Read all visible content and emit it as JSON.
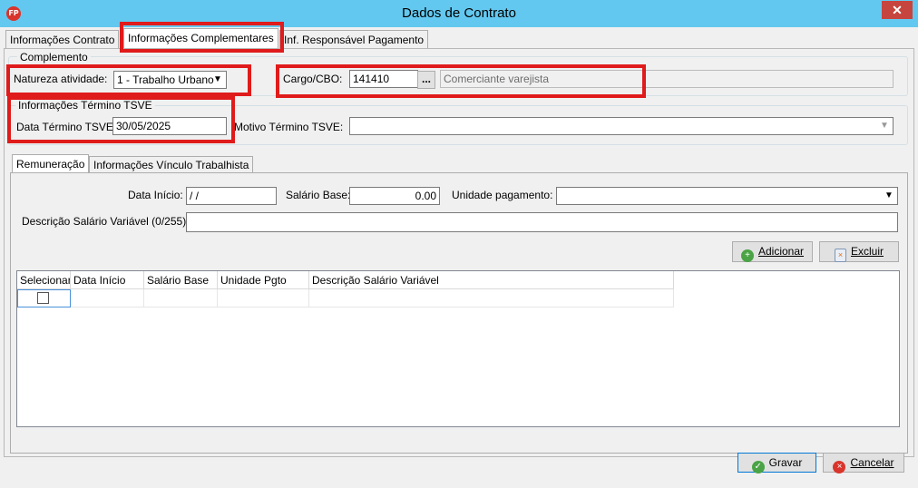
{
  "window": {
    "title": "Dados de Contrato",
    "app_icon": "FP",
    "close_glyph": "✕"
  },
  "tabs": [
    {
      "label": "Informações Contrato"
    },
    {
      "label": "Informações Complementares"
    },
    {
      "label": "Inf. Responsável Pagamento"
    }
  ],
  "complemento": {
    "legend": "Complemento",
    "natureza_label": "Natureza atividade:",
    "natureza_value": "1 - Trabalho Urbano",
    "cargo_label": "Cargo/CBO:",
    "cargo_value": "141410",
    "lookup_label": "...",
    "cargo_desc": "Comerciante varejista"
  },
  "termino": {
    "legend": "Informações Término TSVE",
    "data_label": "Data Término TSVE:",
    "data_value": "30/05/2025",
    "motivo_label": "Motivo Término TSVE:",
    "motivo_value": ""
  },
  "subtabs": [
    {
      "label": "Remuneração"
    },
    {
      "label": "Informações Vínculo Trabalhista"
    }
  ],
  "remuneracao": {
    "data_inicio_label": "Data Início:",
    "data_inicio_value": " / /",
    "salario_label": "Salário Base:",
    "salario_value": "0.00",
    "unidade_label": "Unidade pagamento:",
    "unidade_value": "",
    "descricao_label": "Descrição Salário Variável (0/255):",
    "descricao_value": "",
    "adicionar_label": "Adicionar",
    "excluir_label": "Excluir"
  },
  "grid": {
    "columns": [
      "Selecionar",
      "Data Início",
      "Salário Base",
      "Unidade Pgto",
      "Descrição Salário Variável"
    ],
    "rows": [
      [
        "",
        "",
        "",
        "",
        ""
      ]
    ]
  },
  "footer": {
    "gravar_label": "Gravar",
    "cancelar_label": "Cancelar"
  },
  "colors": {
    "titlebar": "#63c8ef",
    "highlight": "#e01b1b",
    "close": "#c7453f"
  },
  "icons": [
    "app-logo-icon",
    "close-icon",
    "chevron-down-icon",
    "add-icon",
    "delete-icon",
    "check-icon",
    "cancel-icon"
  ]
}
